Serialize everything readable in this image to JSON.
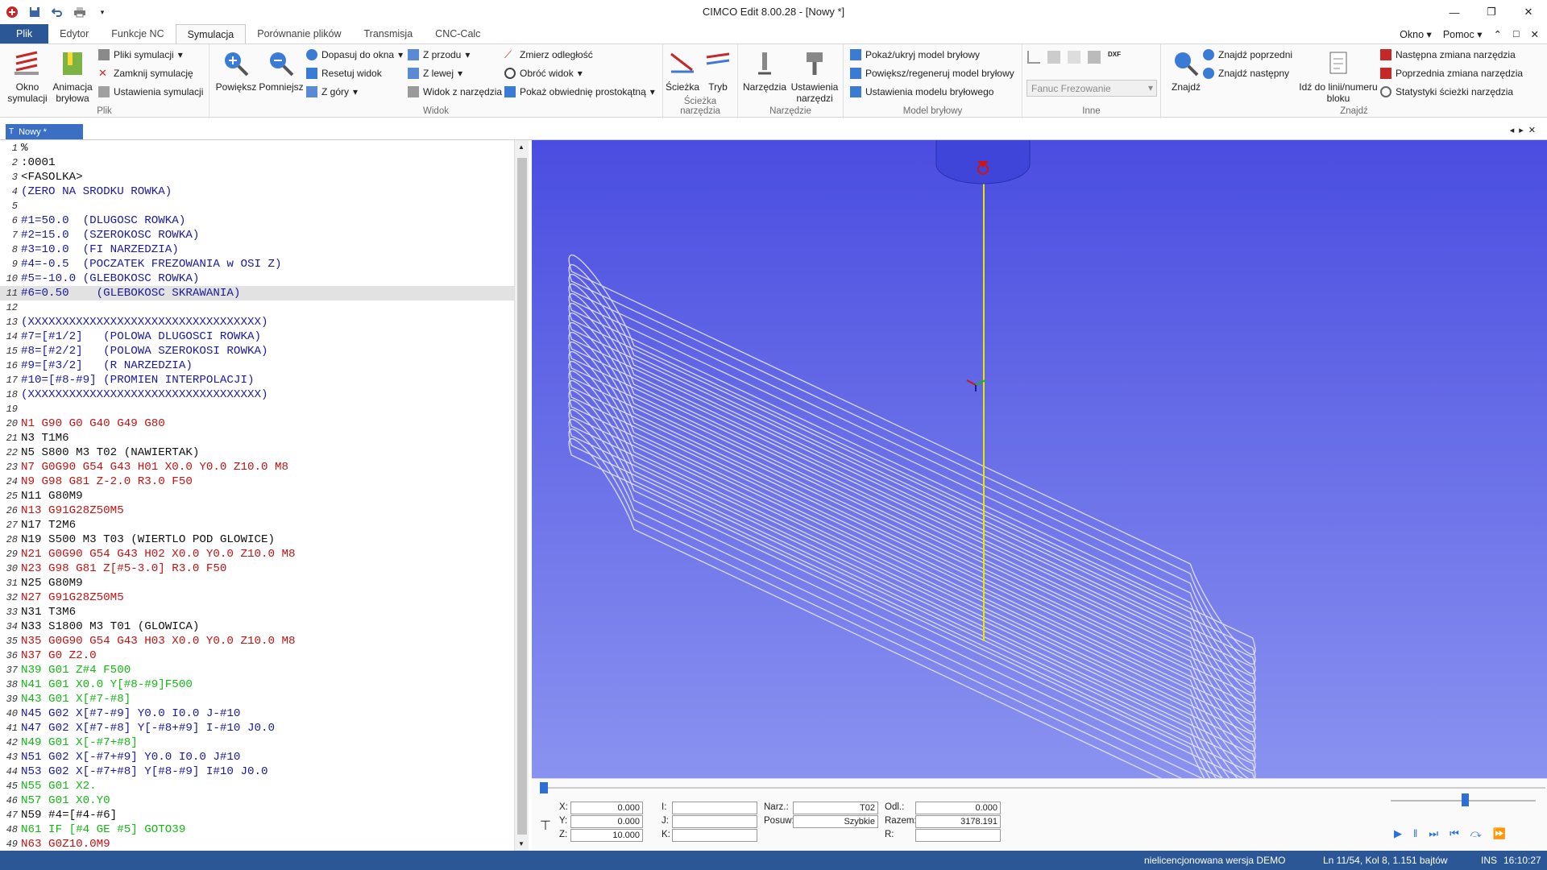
{
  "app": {
    "title": "CIMCO Edit 8.00.28 - [Nowy *]"
  },
  "tabs": [
    "Plik",
    "Edytor",
    "Funkcje NC",
    "Symulacja",
    "Porównanie plików",
    "Transmisja",
    "CNC-Calc"
  ],
  "tabs_right": {
    "window": "Okno",
    "help": "Pomoc"
  },
  "ribbon": {
    "plik": {
      "label": "Plik",
      "okno_symulacji": "Okno symulacji",
      "animacja_brylowa": "Animacja bryłowa",
      "pliki_symulacji": "Pliki symulacji",
      "zamknij_symulacje": "Zamknij symulację",
      "ustawienia_symulacji": "Ustawienia symulacji"
    },
    "widok": {
      "label": "Widok",
      "powieksz": "Powiększ",
      "pomniejsz": "Pomniejsz",
      "dopasuj": "Dopasuj do okna",
      "resetuj": "Resetuj widok",
      "z_gory": "Z góry",
      "z_przodu": "Z przodu",
      "z_lewej": "Z lewej",
      "widok_z_narzedzia": "Widok z narzędzia",
      "zmierz": "Zmierz odległość",
      "obroc": "Obróć widok",
      "obwiednia": "Pokaż obwiednię prostokątną"
    },
    "sciezka": {
      "label": "Ścieżka narzędzia",
      "sciezka": "Ścieżka",
      "tryb": "Tryb"
    },
    "narzedzie": {
      "label": "Narzędzie",
      "narzedzia": "Narzędzia",
      "ustawienia": "Ustawienia narzędzi"
    },
    "model": {
      "label": "Model bryłowy",
      "pokaz": "Pokaż/ukryj model bryłowy",
      "powieksz": "Powiększ/regeneruj model bryłowy",
      "ustawienia": "Ustawienia modelu bryłowego"
    },
    "inne": {
      "label": "Inne",
      "machine": "Fanuc Frezowanie"
    },
    "znajdz": {
      "label": "Znajdź",
      "znajdz": "Znajdź",
      "poprzedni": "Znajdź poprzedni",
      "nastepny": "Znajdź następny",
      "idz_do": "Idź do linii/numeru bloku",
      "nastepna_zmiana": "Następna zmiana narzędzia",
      "poprzednia_zmiana": "Poprzednia zmiana narzędzia",
      "statystyki": "Statystyki ścieżki narzędzia"
    }
  },
  "document_tab": "Nowy *",
  "editor": {
    "current_line": 11,
    "lines": [
      {
        "n": "1",
        "t": "%",
        "c": "black"
      },
      {
        "n": "2",
        "t": ":0001",
        "c": "black"
      },
      {
        "n": "3",
        "t": "<FASOLKA>",
        "c": "black"
      },
      {
        "n": "4",
        "t": "(ZERO NA SRODKU ROWKA)",
        "c": "blue"
      },
      {
        "n": "5",
        "t": "",
        "c": "black"
      },
      {
        "n": "6",
        "t": "#1=50.0  (DLUGOSC ROWKA)",
        "c": "blue"
      },
      {
        "n": "7",
        "t": "#2=15.0  (SZEROKOSC ROWKA)",
        "c": "blue"
      },
      {
        "n": "8",
        "t": "#3=10.0  (FI NARZEDZIA)",
        "c": "blue"
      },
      {
        "n": "9",
        "t": "#4=-0.5  (POCZATEK FREZOWANIA w OSI Z)",
        "c": "blue"
      },
      {
        "n": "10",
        "t": "#5=-10.0 (GLEBOKOSC ROWKA)",
        "c": "blue"
      },
      {
        "n": "11",
        "t": "#6=0.50    (GLEBOKOSC SKRAWANIA)",
        "c": "blue"
      },
      {
        "n": "12",
        "t": "",
        "c": "black"
      },
      {
        "n": "13",
        "t": "(XXXXXXXXXXXXXXXXXXXXXXXXXXXXXXXXXX)",
        "c": "blue"
      },
      {
        "n": "14",
        "t": "#7=[#1/2]   (POLOWA DLUGOSCI ROWKA)",
        "c": "blue"
      },
      {
        "n": "15",
        "t": "#8=[#2/2]   (POLOWA SZEROKOSI ROWKA)",
        "c": "blue"
      },
      {
        "n": "16",
        "t": "#9=[#3/2]   (R NARZEDZIA)",
        "c": "blue"
      },
      {
        "n": "17",
        "t": "#10=[#8-#9] (PROMIEN INTERPOLACJI)",
        "c": "blue"
      },
      {
        "n": "18",
        "t": "(XXXXXXXXXXXXXXXXXXXXXXXXXXXXXXXXXX)",
        "c": "blue"
      },
      {
        "n": "19",
        "t": "",
        "c": "black"
      },
      {
        "n": "20",
        "t": "N1 G90 G0 G40 G49 G80",
        "c": "red"
      },
      {
        "n": "21",
        "t": "N3 T1M6",
        "c": "black"
      },
      {
        "n": "22",
        "t": "N5 S800 M3 T02 (NAWIERTAK)",
        "c": "black"
      },
      {
        "n": "23",
        "t": "N7 G0G90 G54 G43 H01 X0.0 Y0.0 Z10.0 M8",
        "c": "red"
      },
      {
        "n": "24",
        "t": "N9 G98 G81 Z-2.0 R3.0 F50",
        "c": "red"
      },
      {
        "n": "25",
        "t": "N11 G80M9",
        "c": "black"
      },
      {
        "n": "26",
        "t": "N13 G91G28Z50M5",
        "c": "red"
      },
      {
        "n": "27",
        "t": "N17 T2M6",
        "c": "black"
      },
      {
        "n": "28",
        "t": "N19 S500 M3 T03 (WIERTLO POD GLOWICE)",
        "c": "black"
      },
      {
        "n": "29",
        "t": "N21 G0G90 G54 G43 H02 X0.0 Y0.0 Z10.0 M8",
        "c": "red"
      },
      {
        "n": "30",
        "t": "N23 G98 G81 Z[#5-3.0] R3.0 F50",
        "c": "red"
      },
      {
        "n": "31",
        "t": "N25 G80M9",
        "c": "black"
      },
      {
        "n": "32",
        "t": "N27 G91G28Z50M5",
        "c": "red"
      },
      {
        "n": "33",
        "t": "N31 T3M6",
        "c": "black"
      },
      {
        "n": "34",
        "t": "N33 S1800 M3 T01 (GLOWICA)",
        "c": "black"
      },
      {
        "n": "35",
        "t": "N35 G0G90 G54 G43 H03 X0.0 Y0.0 Z10.0 M8",
        "c": "red"
      },
      {
        "n": "36",
        "t": "N37 G0 Z2.0",
        "c": "red"
      },
      {
        "n": "37",
        "t": "N39 G01 Z#4 F500",
        "c": "green"
      },
      {
        "n": "38",
        "t": "N41 G01 X0.0 Y[#8-#9]F500",
        "c": "green"
      },
      {
        "n": "39",
        "t": "N43 G01 X[#7-#8]",
        "c": "green"
      },
      {
        "n": "40",
        "t": "N45 G02 X[#7-#9] Y0.0 I0.0 J-#10",
        "c": "blue"
      },
      {
        "n": "41",
        "t": "N47 G02 X[#7-#8] Y[-#8+#9] I-#10 J0.0",
        "c": "blue"
      },
      {
        "n": "42",
        "t": "N49 G01 X[-#7+#8]",
        "c": "green"
      },
      {
        "n": "43",
        "t": "N51 G02 X[-#7+#9] Y0.0 I0.0 J#10",
        "c": "blue"
      },
      {
        "n": "44",
        "t": "N53 G02 X[-#7+#8] Y[#8-#9] I#10 J0.0",
        "c": "blue"
      },
      {
        "n": "45",
        "t": "N55 G01 X2.",
        "c": "green"
      },
      {
        "n": "46",
        "t": "N57 G01 X0.Y0",
        "c": "green"
      },
      {
        "n": "47",
        "t": "N59 #4=[#4-#6]",
        "c": "black"
      },
      {
        "n": "48",
        "t": "N61 IF [#4 GE #5] GOTO39",
        "c": "green"
      },
      {
        "n": "49",
        "t": "N63 G0Z10.0M9",
        "c": "red"
      }
    ]
  },
  "sim": {
    "x_label": "X:",
    "x": "0.000",
    "y_label": "Y:",
    "y": "0.000",
    "z_label": "Z:",
    "z": "10.000",
    "i_label": "I:",
    "j_label": "J:",
    "k_label": "K:",
    "narz_label": "Narz.:",
    "narz": "T02",
    "posuw_label": "Posuw:",
    "posuw": "Szybkie",
    "odl_label": "Odl.:",
    "odl": "0.000",
    "razem_label": "Razem:",
    "razem": "3178.191",
    "r_label": "R:"
  },
  "colors": {
    "ribbon_accent": "#2b5797",
    "view_top": "#4a4de0",
    "view_bottom": "#8a92f0",
    "path": "#e8e8f4",
    "tool_line": "#e6e600"
  },
  "status": {
    "license": "nielicencjonowana wersja DEMO",
    "position": "Ln 11/54, Kol 8, 1.151 bajtów",
    "mode": "INS",
    "time": "16:10:27"
  }
}
